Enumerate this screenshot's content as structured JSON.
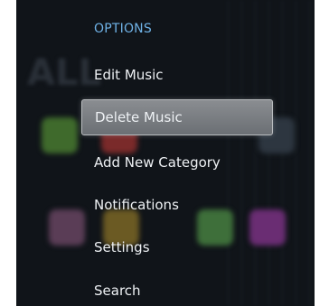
{
  "menu": {
    "header": "OPTIONS",
    "selected_index": 1,
    "items": [
      {
        "label": "Edit Music"
      },
      {
        "label": "Delete Music"
      },
      {
        "label": "Add New Category"
      },
      {
        "label": "Notifications"
      },
      {
        "label": "Settings"
      },
      {
        "label": "Search"
      }
    ]
  },
  "colors": {
    "header": "#6fb2e6",
    "background": "#101419",
    "highlight": "#7c8085",
    "text": "#eef1f4"
  }
}
